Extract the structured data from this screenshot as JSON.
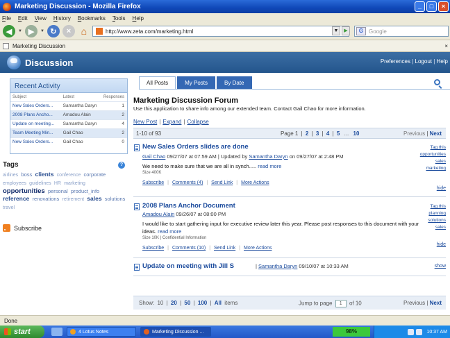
{
  "window": {
    "title": "Marketing Discussion - Mozilla Firefox"
  },
  "menu": [
    "File",
    "Edit",
    "View",
    "History",
    "Bookmarks",
    "Tools",
    "Help"
  ],
  "address": {
    "url": "http://www.zeta.com/marketing.html",
    "search_placeholder": "Google"
  },
  "browser_tab": {
    "label": "Marketing Discussion",
    "close": "×"
  },
  "app": {
    "title": "Discussion",
    "links": {
      "preferences": "Preferences",
      "logout": "Logout",
      "help": "Help",
      "sep": "|"
    }
  },
  "recent": {
    "title": "Recent Activity",
    "headers": {
      "subject": "Subject",
      "latest": "Latest",
      "responses": "Responses"
    },
    "rows": [
      {
        "subject": "New Sales Orders...",
        "latest": "Samantha Daryn",
        "responses": "1"
      },
      {
        "subject": "2008 Plans Ancho...",
        "latest": "Amadou Alain",
        "responses": "2"
      },
      {
        "subject": "Update on meeting...",
        "latest": "Samantha Daryn",
        "responses": "4"
      },
      {
        "subject": "Team Meeting Min...",
        "latest": "Gail Chao",
        "responses": "2"
      },
      {
        "subject": "New Sales Orders...",
        "latest": "Gail Chao",
        "responses": "0"
      }
    ]
  },
  "tags": {
    "title": "Tags",
    "cloud": [
      {
        "text": "airlines",
        "w": 1
      },
      {
        "text": "boss",
        "w": 2
      },
      {
        "text": "clients",
        "w": 3
      },
      {
        "text": "conference",
        "w": 1
      },
      {
        "text": "corporate",
        "w": 2
      },
      {
        "text": "employees",
        "w": 1
      },
      {
        "text": "guidelines",
        "w": 1
      },
      {
        "text": "HR",
        "w": 1
      },
      {
        "text": "marketing",
        "w": 1
      },
      {
        "text": "opportunities",
        "w": 4
      },
      {
        "text": "personal",
        "w": 2
      },
      {
        "text": "product_info",
        "w": 2
      },
      {
        "text": "reference",
        "w": 3
      },
      {
        "text": "renovations",
        "w": 2
      },
      {
        "text": "retirement",
        "w": 1
      },
      {
        "text": "sales",
        "w": 3
      },
      {
        "text": "solutions",
        "w": 2
      },
      {
        "text": "travel",
        "w": 1
      }
    ],
    "subscribe": "Subscribe"
  },
  "tabs": [
    "All Posts",
    "My Posts",
    "By Date"
  ],
  "forum": {
    "title": "Marketing Discussion Forum",
    "description": "Use this application to share info among our extended team. Contact Gail Chao for more information.",
    "actions": [
      "New Post",
      "Expand",
      "Collapse"
    ]
  },
  "pager": {
    "range": "1-10 of 93",
    "page_label": "Page 1",
    "pages": [
      "2",
      "3",
      "4",
      "5",
      "...",
      "10"
    ],
    "previous": "Previous",
    "next": "Next"
  },
  "posts": [
    {
      "title": "New Sales Orders slides are done",
      "author": "Gail Chao",
      "meta_rest": "09/27/07 at 07:59 AM  |  Updated by",
      "updater": "Samantha Daryn",
      "meta_tail": "on 09/27/07 at 2:48 PM",
      "body": "We need to make sure that we are all in synch.....",
      "read_more": "read more",
      "size": "Size 400K",
      "links": [
        "Subscribe",
        "Comments (4)",
        "Send Link",
        "More Actions"
      ],
      "tag_this": "Tag this",
      "tags": [
        "opportunities",
        "sales",
        "marketing"
      ],
      "toggle": "hide"
    },
    {
      "title": "2008 Plans Anchor Document",
      "author": "Amadou Alain",
      "meta_rest": "09/26/07 at 08:00 PM",
      "body": "I would like to start gathering input for executive review later this year. Please post responses to this document with your ideas.",
      "read_more": "read more",
      "size": "Size 10K  |  Confidential Information",
      "links": [
        "Subscribe",
        "Comments (10)",
        "Send Link",
        "More Actions"
      ],
      "tag_this": "Tag this",
      "tags": [
        "planning",
        "solutions",
        "sales"
      ],
      "toggle": "hide"
    },
    {
      "title": "Update on meeting with Jill S",
      "sep": "|",
      "author": "Samantha Daryn",
      "meta_rest": "09/10/07 at 10:33 AM",
      "toggle": "show"
    }
  ],
  "footer": {
    "show_label": "Show:",
    "show_options": [
      "10",
      "20",
      "50",
      "100",
      "All"
    ],
    "items_label": "items",
    "jump_label": "Jump to page",
    "jump_value": "1",
    "of_label": "of 10",
    "previous": "Previous",
    "next": "Next"
  },
  "status": "Done",
  "taskbar": {
    "start": "start",
    "items": [
      "4 Lotus Notes",
      "Marketing Discussion ..."
    ],
    "battery": "98%",
    "clock": "10:37 AM"
  },
  "colors": {
    "header": "#2f629a",
    "link": "#1a4a9c",
    "tab_active": "#3468b4"
  }
}
